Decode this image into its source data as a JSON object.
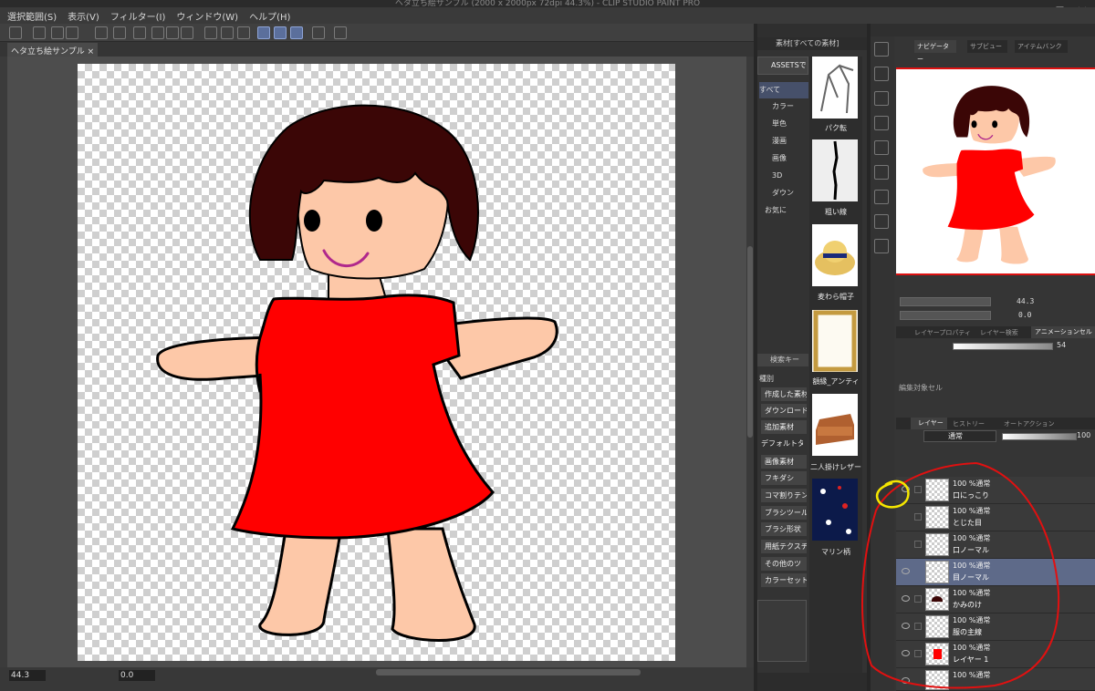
{
  "window": {
    "title": "ヘタ立ち絵サンプル (2000 x 2000px 72dpi 44.3%) - CLIP STUDIO PAINT PRO"
  },
  "menu": {
    "items": [
      "選択範囲(S)",
      "表示(V)",
      "フィルター(I)",
      "ウィンドウ(W)",
      "ヘルプ(H)"
    ]
  },
  "document": {
    "tab_label": "ヘタ立ち絵サンプル ×"
  },
  "status": {
    "zoom": "44.3",
    "rotation": "0.0"
  },
  "materials": {
    "header": "素材[すべての素材]",
    "assets_button": "ASSETSで",
    "tree": [
      "すべて",
      "カラー",
      "単色",
      "漫画",
      "画像",
      "3D",
      "ダウン",
      "お気に"
    ],
    "thumbnails": [
      "パク転",
      "粗い線",
      "麦わら帽子",
      "額縁_アンティ",
      "二人掛けレザー",
      "マリン柄"
    ],
    "search_placeholder": "検索キー",
    "kind_label": "種別",
    "tags": [
      "作成した素材",
      "ダウンロード",
      "追加素材",
      "デフォルトタ",
      "画像素材",
      "フキダシ",
      "コマ割りテン",
      "ブラシツール",
      "ブラシ形状",
      "用紙テクスチャ",
      "その他のツ",
      "カラーセット"
    ]
  },
  "navigator": {
    "tabs": [
      "ナビゲーター",
      "サブビュー",
      "アイテムバンク"
    ],
    "zoom": "44.3",
    "rotation": "0.0"
  },
  "animation": {
    "tabs": [
      "レイヤープロパティ",
      "レイヤー検索",
      "アニメーションセル"
    ],
    "onion_value": "54",
    "cell_label": "編集対象セル"
  },
  "layers": {
    "tabs": [
      "レイヤー",
      "ヒストリー",
      "オートアクション"
    ],
    "blend_mode": "通常",
    "opacity": "100",
    "rows": [
      {
        "mode": "100 %通常",
        "name": "口にっこり"
      },
      {
        "mode": "100 %通常",
        "name": "とじた目"
      },
      {
        "mode": "100 %通常",
        "name": "口ノーマル"
      },
      {
        "mode": "100 %通常",
        "name": "目ノーマル"
      },
      {
        "mode": "100 %通常",
        "name": "かみのけ"
      },
      {
        "mode": "100 %通常",
        "name": "服の主線"
      },
      {
        "mode": "100 %通常",
        "name": "レイヤー 1"
      },
      {
        "mode": "100 %通常",
        "name": ""
      }
    ]
  },
  "colors": {
    "dress": "#ff0000",
    "hair": "#3b0606",
    "skin": "#fdc8a8",
    "annotation_red": "#e11010",
    "annotation_yellow": "#f5e600"
  }
}
